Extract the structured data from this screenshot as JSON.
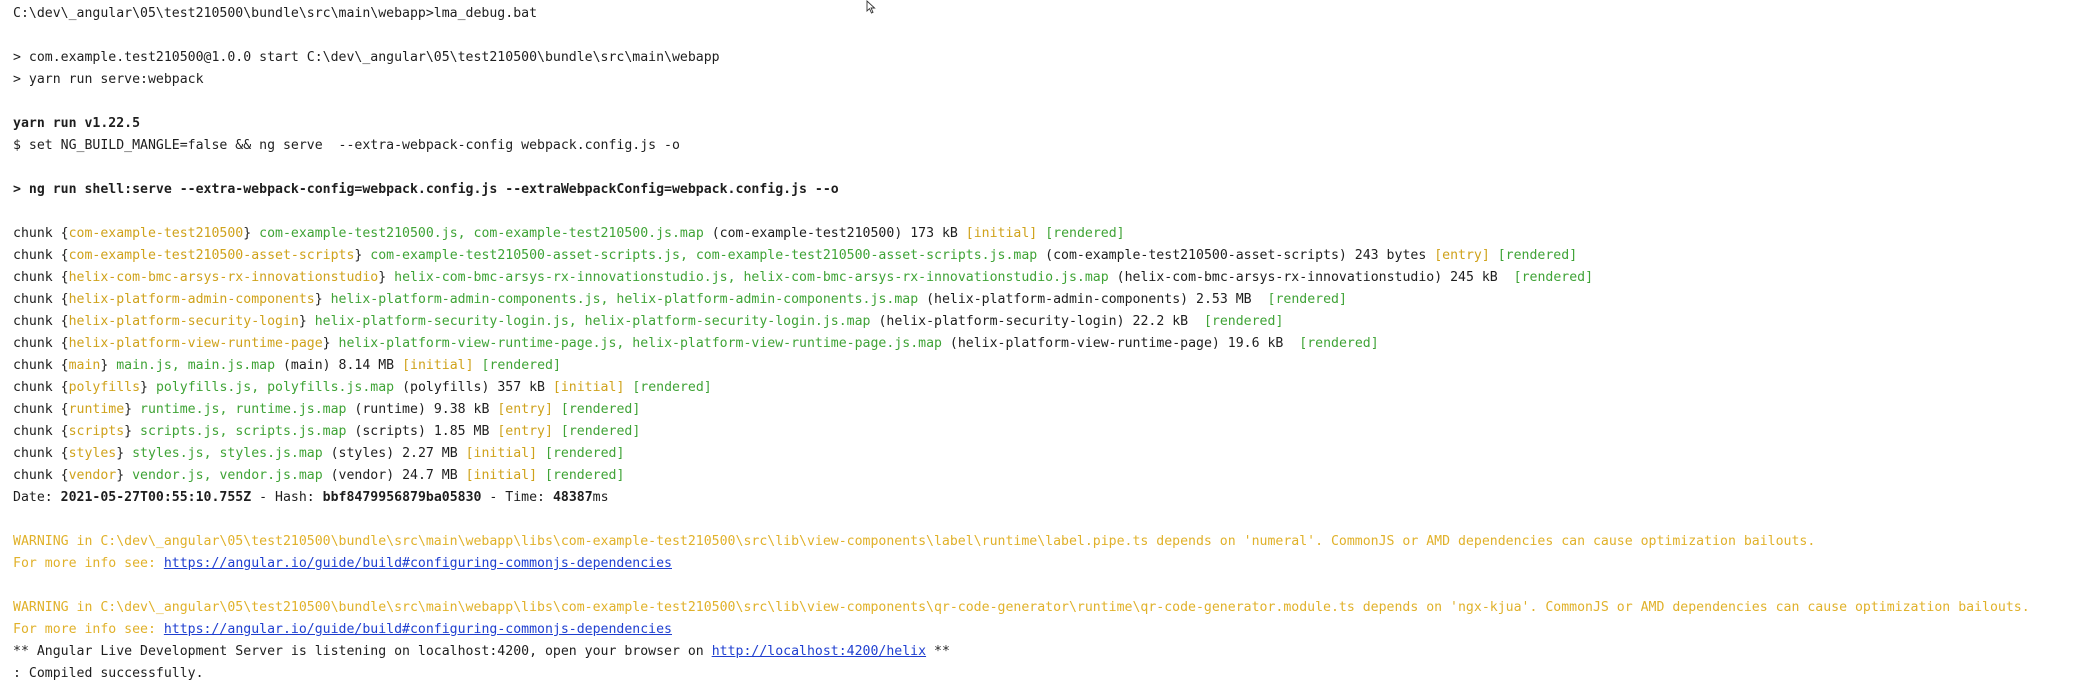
{
  "prompt": {
    "path": "C:\\dev\\_angular\\05\\test210500\\bundle\\src\\main\\webapp>lma_debug.bat"
  },
  "npm": {
    "start_line": "> com.example.test210500@1.0.0 start C:\\dev\\_angular\\05\\test210500\\bundle\\src\\main\\webapp",
    "yarn_line": "> yarn run serve:webpack"
  },
  "yarn": {
    "version_line": "yarn run v1.22.5",
    "set_line": "$ set NG_BUILD_MANGLE=false && ng serve  --extra-webpack-config webpack.config.js -o"
  },
  "ng_run_line": "> ng run shell:serve --extra-webpack-config=webpack.config.js --extraWebpackConfig=webpack.config.js --o",
  "chunks": [
    {
      "prefix": "chunk {",
      "name": "com-example-test210500",
      "mid": "} ",
      "files": "com-example-test210500.js, com-example-test210500.js.map",
      "info": " (com-example-test210500) 173 kB ",
      "tag": "[initial]",
      "sep": " ",
      "rendered": "[rendered]"
    },
    {
      "prefix": "chunk {",
      "name": "com-example-test210500-asset-scripts",
      "mid": "} ",
      "files": "com-example-test210500-asset-scripts.js, com-example-test210500-asset-scripts.js.map",
      "info": " (com-example-test210500-asset-scripts) 243 bytes ",
      "tag": "[entry]",
      "sep": " ",
      "rendered": "[rendered]"
    },
    {
      "prefix": "chunk {",
      "name": "helix-com-bmc-arsys-rx-innovationstudio",
      "mid": "} ",
      "files": "helix-com-bmc-arsys-rx-innovationstudio.js, helix-com-bmc-arsys-rx-innovationstudio.js.map",
      "info": " (helix-com-bmc-arsys-rx-innovationstudio) 245 kB ",
      "tag": "",
      "sep": " ",
      "rendered": "[rendered]"
    },
    {
      "prefix": "chunk {",
      "name": "helix-platform-admin-components",
      "mid": "} ",
      "files": "helix-platform-admin-components.js, helix-platform-admin-components.js.map",
      "info": " (helix-platform-admin-components) 2.53 MB ",
      "tag": "",
      "sep": " ",
      "rendered": "[rendered]"
    },
    {
      "prefix": "chunk {",
      "name": "helix-platform-security-login",
      "mid": "} ",
      "files": "helix-platform-security-login.js, helix-platform-security-login.js.map",
      "info": " (helix-platform-security-login) 22.2 kB ",
      "tag": "",
      "sep": " ",
      "rendered": "[rendered]"
    },
    {
      "prefix": "chunk {",
      "name": "helix-platform-view-runtime-page",
      "mid": "} ",
      "files": "helix-platform-view-runtime-page.js, helix-platform-view-runtime-page.js.map",
      "info": " (helix-platform-view-runtime-page) 19.6 kB ",
      "tag": "",
      "sep": " ",
      "rendered": "[rendered]"
    },
    {
      "prefix": "chunk {",
      "name": "main",
      "mid": "} ",
      "files": "main.js, main.js.map",
      "info": " (main) 8.14 MB ",
      "tag": "[initial]",
      "sep": " ",
      "rendered": "[rendered]"
    },
    {
      "prefix": "chunk {",
      "name": "polyfills",
      "mid": "} ",
      "files": "polyfills.js, polyfills.js.map",
      "info": " (polyfills) 357 kB ",
      "tag": "[initial]",
      "sep": " ",
      "rendered": "[rendered]"
    },
    {
      "prefix": "chunk {",
      "name": "runtime",
      "mid": "} ",
      "files": "runtime.js, runtime.js.map",
      "info": " (runtime) 9.38 kB ",
      "tag": "[entry]",
      "sep": " ",
      "rendered": "[rendered]"
    },
    {
      "prefix": "chunk {",
      "name": "scripts",
      "mid": "} ",
      "files": "scripts.js, scripts.js.map",
      "info": " (scripts) 1.85 MB ",
      "tag": "[entry]",
      "sep": " ",
      "rendered": "[rendered]"
    },
    {
      "prefix": "chunk {",
      "name": "styles",
      "mid": "} ",
      "files": "styles.js, styles.js.map",
      "info": " (styles) 2.27 MB ",
      "tag": "[initial]",
      "sep": " ",
      "rendered": "[rendered]"
    },
    {
      "prefix": "chunk {",
      "name": "vendor",
      "mid": "} ",
      "files": "vendor.js, vendor.js.map",
      "info": " (vendor) 24.7 MB ",
      "tag": "[initial]",
      "sep": " ",
      "rendered": "[rendered]"
    }
  ],
  "build_info": {
    "date_label": "Date: ",
    "date_value": "2021-05-27T00:55:10.755Z",
    "hash_label": " - Hash: ",
    "hash_value": "bbf8479956879ba05830",
    "time_label": " - Time: ",
    "time_value": "48387",
    "time_unit": "ms"
  },
  "warnings": [
    {
      "text": "WARNING in C:\\dev\\_angular\\05\\test210500\\bundle\\src\\main\\webapp\\libs\\com-example-test210500\\src\\lib\\view-components\\label\\runtime\\label.pipe.ts depends on 'numeral'. CommonJS or AMD dependencies can cause optimization bailouts.",
      "more_label": "For more info see: ",
      "link": "https://angular.io/guide/build#configuring-commonjs-dependencies"
    },
    {
      "text": "WARNING in C:\\dev\\_angular\\05\\test210500\\bundle\\src\\main\\webapp\\libs\\com-example-test210500\\src\\lib\\view-components\\qr-code-generator\\runtime\\qr-code-generator.module.ts depends on 'ngx-kjua'. CommonJS or AMD dependencies can cause optimization bailouts.",
      "more_label": "For more info see: ",
      "link": "https://angular.io/guide/build#configuring-commonjs-dependencies"
    }
  ],
  "server": {
    "prefix": "** Angular Live Development Server is listening on localhost:4200, open your browser on ",
    "link": "http://localhost:4200/helix",
    "suffix": " **"
  },
  "compiled": ": Compiled successfully.",
  "colors": {
    "chunk_name": "#cfa21b",
    "files": "#3fa336",
    "warning": "#e0b12a",
    "link": "#1f3fd0"
  },
  "icons": {
    "cursor": "mouse-pointer-icon"
  }
}
